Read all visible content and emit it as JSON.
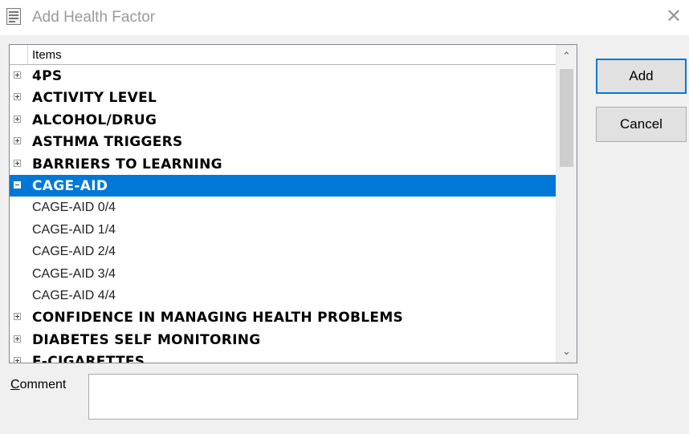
{
  "window": {
    "title": "Add Health Factor",
    "close_glyph": "✕"
  },
  "tree": {
    "column_header": "Items",
    "items": [
      {
        "label": "4PS",
        "level": 0,
        "state": "collapsed",
        "selected": false
      },
      {
        "label": "ACTIVITY LEVEL",
        "level": 0,
        "state": "collapsed",
        "selected": false
      },
      {
        "label": "ALCOHOL/DRUG",
        "level": 0,
        "state": "collapsed",
        "selected": false
      },
      {
        "label": "ASTHMA TRIGGERS",
        "level": 0,
        "state": "collapsed",
        "selected": false
      },
      {
        "label": "BARRIERS TO LEARNING",
        "level": 0,
        "state": "collapsed",
        "selected": false
      },
      {
        "label": "CAGE-AID",
        "level": 0,
        "state": "expanded",
        "selected": true
      },
      {
        "label": "CAGE-AID 0/4",
        "level": 1
      },
      {
        "label": "CAGE-AID 1/4",
        "level": 1
      },
      {
        "label": "CAGE-AID 2/4",
        "level": 1
      },
      {
        "label": "CAGE-AID 3/4",
        "level": 1
      },
      {
        "label": "CAGE-AID 4/4",
        "level": 1
      },
      {
        "label": "CONFIDENCE IN MANAGING HEALTH PROBLEMS",
        "level": 0,
        "state": "collapsed",
        "selected": false
      },
      {
        "label": "DIABETES SELF MONITORING",
        "level": 0,
        "state": "collapsed",
        "selected": false
      },
      {
        "label": "E-CIGARETTES",
        "level": 0,
        "state": "collapsed",
        "selected": false
      }
    ]
  },
  "buttons": {
    "add_label": "Add",
    "cancel_label": "Cancel"
  },
  "comment": {
    "label": "Comment",
    "value": ""
  },
  "colors": {
    "selection": "#0078d7",
    "dialog_bg": "#f0f0f0",
    "default_button_border": "#0078d7"
  },
  "icons": {
    "window_icon": "form-icon",
    "close": "close-icon",
    "expand": "plus-box-icon",
    "collapse": "minus-box-icon",
    "scroll_up": "chevron-up-icon",
    "scroll_down": "chevron-down-icon"
  }
}
